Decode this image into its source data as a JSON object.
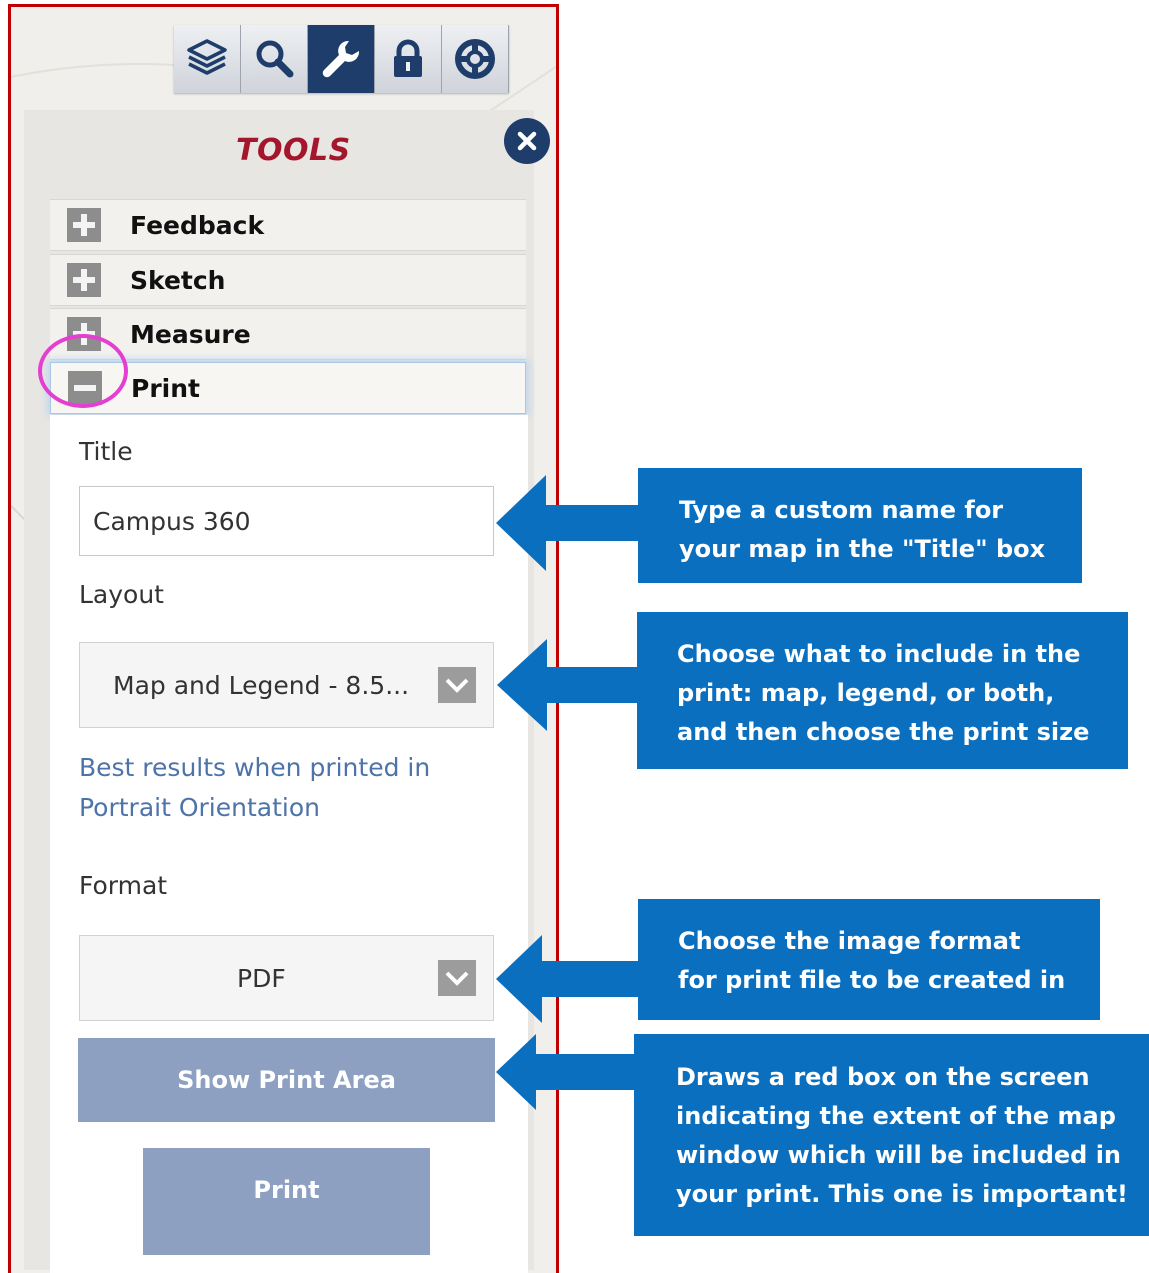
{
  "toolbar": {
    "buttons": [
      {
        "icon": "layers-icon"
      },
      {
        "icon": "search-icon"
      },
      {
        "icon": "wrench-icon",
        "active": true
      },
      {
        "icon": "lock-icon"
      },
      {
        "icon": "lifebuoy-icon"
      }
    ]
  },
  "panel": {
    "title": "TOOLS",
    "accordion": [
      {
        "label": "Feedback",
        "state": "collapsed"
      },
      {
        "label": "Sketch",
        "state": "collapsed"
      },
      {
        "label": "Measure",
        "state": "collapsed"
      },
      {
        "label": "Print",
        "state": "expanded"
      }
    ]
  },
  "print_form": {
    "title_label": "Title",
    "title_value": "Campus 360",
    "layout_label": "Layout",
    "layout_value": "Map and Legend - 8.5...",
    "hint": "Best results when printed in Portrait Orientation",
    "format_label": "Format",
    "format_value": "PDF",
    "show_area_label": "Show Print Area",
    "print_label": "Print"
  },
  "callouts": {
    "title_line1": "Type a custom name for",
    "title_line2": "your map in the \"Title\" box",
    "layout_line1": "Choose what to include in the",
    "layout_line2": "print: map, legend, or both,",
    "layout_line3": "and then choose the print size",
    "format_line1": "Choose the image format",
    "format_line2": "for print file to be created in",
    "area_line1": "Draws a red box on the screen",
    "area_line2": "indicating the extent of the map",
    "area_line3": "window which will be included in",
    "area_line4": "your print. This one is important!"
  },
  "colors": {
    "accent_navy": "#1e3d6b",
    "title_red": "#a3162c",
    "callout_blue": "#0b6fc0",
    "button_blue_gray": "#8da0c2",
    "highlight_magenta": "#e43fd0",
    "frame_red": "#c00000"
  }
}
